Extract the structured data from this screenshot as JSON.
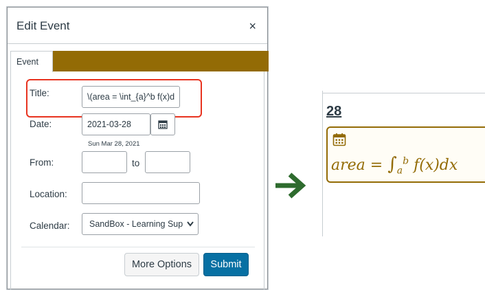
{
  "dialog": {
    "title": "Edit Event",
    "close_glyph": "×",
    "tab_label": "Event",
    "fields": {
      "title_label": "Title:",
      "title_value": "\\(area = \\int_{a}^b f(x)dx\\)",
      "date_label": "Date:",
      "date_value": "2021-03-28",
      "date_readable": "Sun Mar 28, 2021",
      "from_label": "From:",
      "to_label": "to",
      "location_label": "Location:",
      "calendar_label": "Calendar:",
      "calendar_value": "SandBox - Learning Support"
    },
    "buttons": {
      "more_options": "More Options",
      "submit": "Submit"
    }
  },
  "calendar": {
    "day_number": "28",
    "event_formula": {
      "lhs": "area",
      "equals": "=",
      "integral": "∫",
      "lower": "a",
      "upper": "b",
      "integrand": "f(x)dx"
    }
  },
  "colors": {
    "accent_gold": "#936b05",
    "highlight_red": "#e8331f",
    "submit_blue": "#0770a3",
    "arrow_green": "#2e6b2e"
  },
  "icons": {
    "close": "close-icon",
    "date_picker": "calendar-icon",
    "select_chevron": "chevron-down-icon",
    "arrow": "arrow-right-icon",
    "event": "calendar-icon"
  }
}
